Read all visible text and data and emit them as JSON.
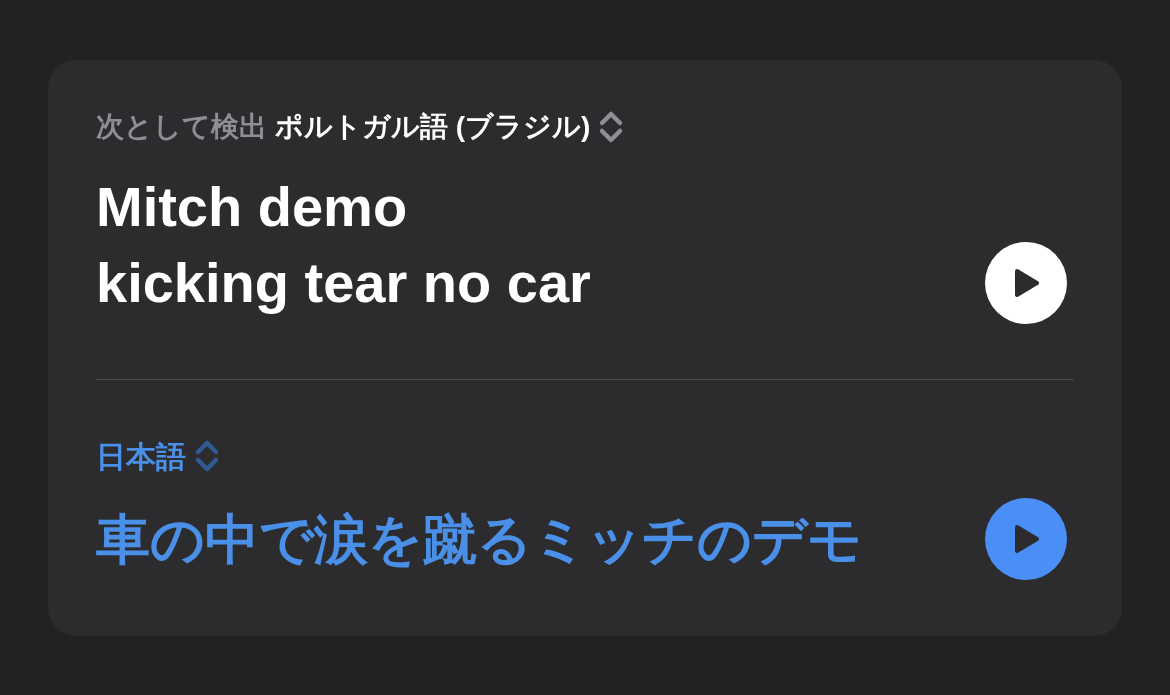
{
  "source": {
    "label": "次として検出",
    "language": "ポルトガル語 (ブラジル)",
    "text_lines": [
      "Mitch demo",
      "kicking tear no car"
    ]
  },
  "target": {
    "language": "日本語",
    "text": "車の中で涙を蹴るミッチのデモ"
  }
}
